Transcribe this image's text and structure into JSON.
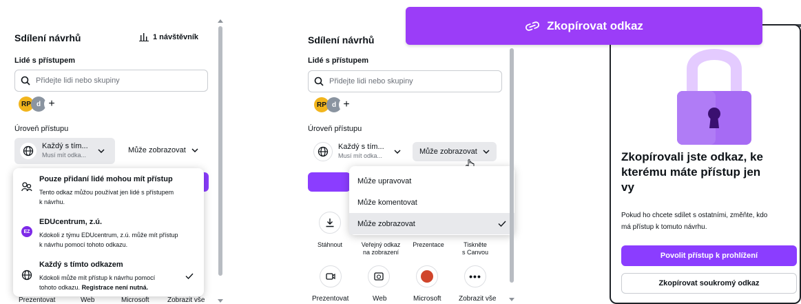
{
  "panel_left": {
    "title": "Sdílení návrhů",
    "visitors": "1 návštěvník",
    "people_label": "Lidé s přístupem",
    "search_placeholder": "Přidejte lidi nebo skupiny",
    "avatars": [
      "RP",
      "d",
      "+"
    ],
    "access_level_label": "Úroveň přístupu",
    "access_title": "Každý s tím...",
    "access_sub": "Musí mít odka...",
    "permission": "Může zobrazovat",
    "dropdown": [
      {
        "title": "Pouze přidaní lidé mohou mít přístup",
        "desc1": "Tento odkaz můžou používat jen lidé s přístupem",
        "desc2": "k návrhu.",
        "icon": "people-icon",
        "badge": ""
      },
      {
        "title": "EDUcentrum, z.ú.",
        "desc1": "Kdokoli z týmu EDUcentrum, z.ú. může mít přístup",
        "desc2": "k návrhu pomocí tohoto odkazu.",
        "icon": "team-badge-icon",
        "badge": "EZ"
      },
      {
        "title": "Každý s tímto odkazem",
        "desc1": "Kdokoli může mít přístup k návrhu pomocí",
        "desc2": "tohoto odkazu.",
        "desc2_bold": "Registrace není nutná.",
        "icon": "globe-icon",
        "badge": ""
      }
    ],
    "bottom": [
      "Prezentovat",
      "Web",
      "Microsoft",
      "Zobrazit vše"
    ]
  },
  "panel_middle": {
    "title": "Sdílení návrhů",
    "people_label": "Lidé s přístupem",
    "search_placeholder": "Přidejte lidi nebo skupiny",
    "avatars": [
      "RP",
      "d",
      "+"
    ],
    "access_level_label": "Úroveň přístupu",
    "access_title": "Každý s tím...",
    "access_sub": "Musí mít odka...",
    "permission": "Může zobrazovat",
    "options": [
      "Může upravovat",
      "Může komentovat",
      "Může zobrazovat"
    ],
    "share_row": [
      {
        "l1": "Stáhnout",
        "l2": ""
      },
      {
        "l1": "Veřejný odkaz",
        "l2": "na zobrazení"
      },
      {
        "l1": "Prezentace",
        "l2": ""
      },
      {
        "l1": "Tiskněte",
        "l2": "s Canvou"
      }
    ],
    "bottom": [
      "Prezentovat",
      "Web",
      "Microsoft",
      "Zobrazit vše"
    ]
  },
  "banner": {
    "label": "Zkopírovat odkaz",
    "icon": "link-icon"
  },
  "modal": {
    "heading_l1": "Zkopírovali jste odkaz, ke",
    "heading_l2": "kterému máte přístup jen",
    "heading_l3": "vy",
    "body_l1": "Pokud ho chcete sdílet s ostatními, změňte, kdo",
    "body_l2": "má přístup k tomuto návrhu.",
    "primary": "Povolit přístup k prohlížení",
    "secondary": "Zkopírovat soukromý odkaz"
  },
  "colors": {
    "accent": "#8b3dff",
    "banner": "#9b3df8",
    "lock": "#a66bf4"
  }
}
